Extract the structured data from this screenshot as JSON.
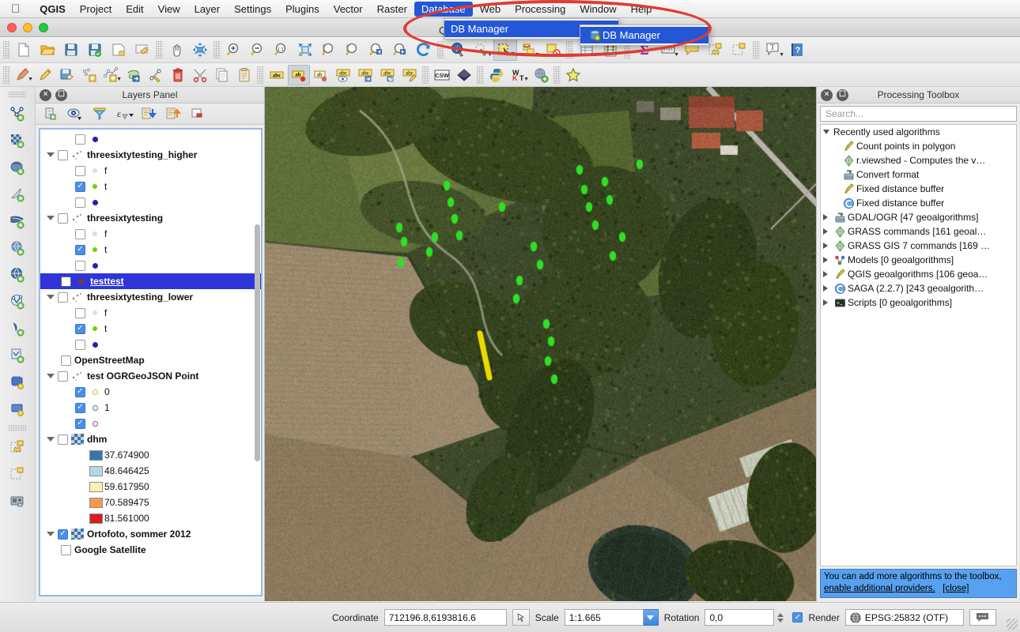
{
  "macmenu": {
    "apple_icon": "apple-icon",
    "items": [
      {
        "label": "QGIS",
        "bold": true,
        "active": false
      },
      {
        "label": "Project",
        "bold": false,
        "active": false
      },
      {
        "label": "Edit",
        "bold": false,
        "active": false
      },
      {
        "label": "View",
        "bold": false,
        "active": false
      },
      {
        "label": "Layer",
        "bold": false,
        "active": false
      },
      {
        "label": "Settings",
        "bold": false,
        "active": false
      },
      {
        "label": "Plugins",
        "bold": false,
        "active": false
      },
      {
        "label": "Vector",
        "bold": false,
        "active": false
      },
      {
        "label": "Raster",
        "bold": false,
        "active": false
      },
      {
        "label": "Database",
        "bold": false,
        "active": true
      },
      {
        "label": "Web",
        "bold": false,
        "active": false
      },
      {
        "label": "Processing",
        "bold": false,
        "active": false
      },
      {
        "label": "Window",
        "bold": false,
        "active": false
      },
      {
        "label": "Help",
        "bold": false,
        "active": false
      }
    ]
  },
  "window": {
    "title": "QGIS"
  },
  "database_menu": {
    "item_label": "DB Manager",
    "submenu_label": "DB Manager"
  },
  "toolbar_row1": [
    {
      "name": "new-project-icon",
      "title": "New Project"
    },
    {
      "name": "open-project-icon",
      "title": "Open Project"
    },
    {
      "name": "save-project-icon",
      "title": "Save Project"
    },
    {
      "name": "save-project-as-icon",
      "title": "Save Project As"
    },
    {
      "name": "new-print-composer-icon",
      "title": "New Print Composer"
    },
    {
      "name": "composer-manager-icon",
      "title": "Composer Manager"
    },
    {
      "name": "pan-map-icon",
      "title": "Pan Map"
    },
    {
      "name": "pan-to-selection-icon",
      "title": "Pan Map to Selection"
    },
    {
      "name": "zoom-in-icon",
      "title": "Zoom In"
    },
    {
      "name": "zoom-out-icon",
      "title": "Zoom Out"
    },
    {
      "name": "zoom-native-icon",
      "title": "Zoom to Native Resolution"
    },
    {
      "name": "zoom-full-icon",
      "title": "Zoom Full"
    },
    {
      "name": "zoom-to-selection-icon",
      "title": "Zoom to Selection"
    },
    {
      "name": "zoom-to-layer-icon",
      "title": "Zoom to Layer"
    },
    {
      "name": "zoom-last-icon",
      "title": "Zoom Last"
    },
    {
      "name": "zoom-next-icon",
      "title": "Zoom Next"
    },
    {
      "name": "refresh-icon",
      "title": "Refresh"
    },
    {
      "name": "identify-features-icon",
      "title": "Identify Features"
    },
    {
      "name": "select-features-icon",
      "title": "Select Features"
    },
    {
      "name": "select-by-rectangle-icon",
      "title": "Select by Rectangle"
    },
    {
      "name": "select-by-value-icon",
      "title": "Select Features by Value"
    },
    {
      "name": "deselect-features-icon",
      "title": "Deselect Features"
    },
    {
      "name": "open-attribute-table-icon",
      "title": "Open Attribute Table"
    },
    {
      "name": "field-calculator-icon",
      "title": "Field Calculator"
    },
    {
      "name": "statistical-summary-icon",
      "title": "Statistical Summary"
    },
    {
      "name": "measure-line-icon",
      "title": "Measure Line"
    },
    {
      "name": "map-tips-icon",
      "title": "Show Map Tips"
    },
    {
      "name": "new-bookmark-icon",
      "title": "New Bookmark"
    },
    {
      "name": "show-bookmarks-icon",
      "title": "Show Bookmarks"
    },
    {
      "name": "text-annotation-icon",
      "title": "Text Annotation"
    },
    {
      "name": "help-icon",
      "title": "Help"
    }
  ],
  "toolbar_row2": [
    {
      "name": "current-edits-icon",
      "title": "Current Edits"
    },
    {
      "name": "toggle-editing-icon",
      "title": "Toggle Editing"
    },
    {
      "name": "save-layer-edits-icon",
      "title": "Save Layer Edits"
    },
    {
      "name": "add-feature-point-icon",
      "title": "Add Feature"
    },
    {
      "name": "add-feature-line-icon",
      "title": "Add Feature Line"
    },
    {
      "name": "move-feature-icon",
      "title": "Move Feature"
    },
    {
      "name": "node-tool-icon",
      "title": "Node Tool"
    },
    {
      "name": "delete-selected-icon",
      "title": "Delete Selected"
    },
    {
      "name": "cut-features-icon",
      "title": "Cut Features"
    },
    {
      "name": "copy-features-icon",
      "title": "Copy Features"
    },
    {
      "name": "paste-features-icon",
      "title": "Paste Features"
    },
    {
      "name": "layer-labeling-icon",
      "title": "Layer Labeling Options"
    },
    {
      "name": "highlight-pinned-labels-icon",
      "title": "Highlight Pinned Labels"
    },
    {
      "name": "pin-labels-icon",
      "title": "Pin/Unpin Labels"
    },
    {
      "name": "show-hide-labels-icon",
      "title": "Show/Hide Labels"
    },
    {
      "name": "move-label-icon",
      "title": "Move Label"
    },
    {
      "name": "rotate-label-icon",
      "title": "Rotate Label"
    },
    {
      "name": "change-label-icon",
      "title": "Change Label"
    },
    {
      "name": "csw-icon",
      "title": "MetaSearch CSW"
    },
    {
      "name": "diamond-plugin-icon",
      "title": "Plugin"
    },
    {
      "name": "python-console-icon",
      "title": "Python Console"
    },
    {
      "name": "wkt-icon",
      "title": "WKT Tool"
    },
    {
      "name": "add-web-service-icon",
      "title": "Add Web Service"
    },
    {
      "name": "favorites-star-icon",
      "title": "Favorites"
    }
  ],
  "left_toolbar": [
    {
      "name": "add-vector-layer-icon",
      "title": "Add Vector Layer"
    },
    {
      "name": "add-raster-layer-icon",
      "title": "Add Raster Layer"
    },
    {
      "name": "add-postgis-layer-icon",
      "title": "Add PostGIS Layer"
    },
    {
      "name": "add-spatialite-layer-icon",
      "title": "Add SpatiaLite Layer"
    },
    {
      "name": "add-mssql-layer-icon",
      "title": "Add MSSQL Spatial Layer"
    },
    {
      "name": "add-oracle-layer-icon",
      "title": "Add Oracle Spatial Layer"
    },
    {
      "name": "add-wms-layer-icon",
      "title": "Add WMS/WMTS Layer"
    },
    {
      "name": "add-wcs-layer-icon",
      "title": "Add WCS Layer"
    },
    {
      "name": "add-wfs-layer-icon",
      "title": "Add WFS Layer"
    },
    {
      "name": "add-delimited-text-icon",
      "title": "Add Delimited Text Layer"
    },
    {
      "name": "new-shapefile-layer-icon",
      "title": "New Shapefile Layer"
    },
    {
      "name": "new-memory-layer-icon",
      "title": "New Memory Layer"
    },
    {
      "name": "new-bookmark-icon",
      "title": "New Bookmark"
    },
    {
      "name": "show-bookmarks-icon",
      "title": "Show Bookmarks"
    },
    {
      "name": "open-attribute-icon",
      "title": "Open Table"
    }
  ],
  "layers_panel": {
    "title": "Layers Panel",
    "toolbar": [
      {
        "name": "add-group-icon",
        "title": "Add Group"
      },
      {
        "name": "manage-layer-visibility-icon",
        "title": "Manage Layer Visibility"
      },
      {
        "name": "filter-legend-icon",
        "title": "Filter Legend by Map Content"
      },
      {
        "name": "filter-legend-expression-icon",
        "title": "Filter Legend by Expression"
      },
      {
        "name": "expand-all-icon",
        "title": "Expand All"
      },
      {
        "name": "collapse-all-icon",
        "title": "Collapse All"
      },
      {
        "name": "remove-layer-icon",
        "title": "Remove Layer/Group"
      }
    ],
    "rows": [
      {
        "type": "symbol",
        "indent": 2,
        "checked": false,
        "symbol": "dot",
        "color": "#2222aa",
        "label": ""
      },
      {
        "type": "layer",
        "indent": 0,
        "expand": "down",
        "checked": false,
        "symbol": "points",
        "label": "threesixtytesting_higher",
        "bold": true
      },
      {
        "type": "symbol",
        "indent": 2,
        "checked": false,
        "symbol": "dot",
        "color": "#efd6cf",
        "label": "f"
      },
      {
        "type": "symbol",
        "indent": 2,
        "checked": true,
        "symbol": "dot",
        "color": "#6dd400",
        "label": "t"
      },
      {
        "type": "symbol",
        "indent": 2,
        "checked": false,
        "symbol": "dot",
        "color": "#2222aa",
        "label": ""
      },
      {
        "type": "layer",
        "indent": 0,
        "expand": "down",
        "checked": false,
        "symbol": "points",
        "label": "threesixtytesting",
        "bold": true
      },
      {
        "type": "symbol",
        "indent": 2,
        "checked": false,
        "symbol": "dot",
        "color": "#efd6cf",
        "label": "f"
      },
      {
        "type": "symbol",
        "indent": 2,
        "checked": true,
        "symbol": "dot",
        "color": "#6dd400",
        "label": "t"
      },
      {
        "type": "symbol",
        "indent": 2,
        "checked": false,
        "symbol": "dot",
        "color": "#2222aa",
        "label": ""
      },
      {
        "type": "layer",
        "indent": 1,
        "checked": false,
        "symbol": "dot",
        "color": "#7a3b3b",
        "label": "testtest",
        "selected": true
      },
      {
        "type": "layer",
        "indent": 0,
        "expand": "down",
        "checked": false,
        "symbol": "points",
        "label": "threesixtytesting_lower",
        "bold": true
      },
      {
        "type": "symbol",
        "indent": 2,
        "checked": false,
        "symbol": "dot",
        "color": "#efd6cf",
        "label": "f"
      },
      {
        "type": "symbol",
        "indent": 2,
        "checked": true,
        "symbol": "dot",
        "color": "#6dd400",
        "label": "t"
      },
      {
        "type": "symbol",
        "indent": 2,
        "checked": false,
        "symbol": "dot",
        "color": "#2222aa",
        "label": ""
      },
      {
        "type": "layer",
        "indent": 1,
        "checked": false,
        "symbol": "none",
        "label": "OpenStreetMap",
        "bold": true
      },
      {
        "type": "layer",
        "indent": 0,
        "expand": "down",
        "checked": false,
        "symbol": "points",
        "label": "test OGRGeoJSON Point",
        "bold": true
      },
      {
        "type": "symbol",
        "indent": 2,
        "checked": true,
        "symbol": "ring",
        "color": "#b5c733",
        "label": "0"
      },
      {
        "type": "symbol",
        "indent": 2,
        "checked": true,
        "symbol": "ring",
        "color": "#4c7f85",
        "label": "1"
      },
      {
        "type": "symbol",
        "indent": 2,
        "checked": true,
        "symbol": "ring",
        "color": "#a23fa0",
        "label": ""
      },
      {
        "type": "raster",
        "indent": 0,
        "expand": "down",
        "checked": false,
        "label": "dhm",
        "bold": true
      },
      {
        "type": "ramp",
        "indent": 2,
        "color": "#3776ad",
        "label": "37.674900"
      },
      {
        "type": "ramp",
        "indent": 2,
        "color": "#b6d7e8",
        "label": "48.646425"
      },
      {
        "type": "ramp",
        "indent": 2,
        "color": "#fdf0b4",
        "label": "59.617950"
      },
      {
        "type": "ramp",
        "indent": 2,
        "color": "#f79a50",
        "label": "70.589475"
      },
      {
        "type": "ramp",
        "indent": 2,
        "color": "#d62020",
        "label": "81.561000"
      },
      {
        "type": "raster",
        "indent": 0,
        "expand": "down",
        "checked": true,
        "label": "Ortofoto, sommer 2012",
        "bold": true
      },
      {
        "type": "layer",
        "indent": 1,
        "checked": false,
        "symbol": "none",
        "label": "Google Satellite",
        "bold": true
      }
    ]
  },
  "processing_panel": {
    "title": "Processing Toolbox",
    "search_placeholder": "Search...",
    "tree": [
      {
        "level": 0,
        "expand": "down",
        "icon": "none",
        "label": "Recently used algorithms"
      },
      {
        "level": 1,
        "expand": "none",
        "icon": "qgis-algorithm-icon",
        "label": "Count points in polygon"
      },
      {
        "level": 1,
        "expand": "none",
        "icon": "grass-algorithm-icon",
        "label": "r.viewshed - Computes the v…"
      },
      {
        "level": 1,
        "expand": "none",
        "icon": "gdal-algorithm-icon",
        "label": "Convert format"
      },
      {
        "level": 1,
        "expand": "none",
        "icon": "qgis-algorithm-icon",
        "label": "Fixed distance buffer"
      },
      {
        "level": 1,
        "expand": "none",
        "icon": "saga-algorithm-icon",
        "label": "Fixed distance buffer"
      },
      {
        "level": 0,
        "expand": "right",
        "icon": "gdal-algorithm-icon",
        "label": "GDAL/OGR [47 geoalgorithms]"
      },
      {
        "level": 0,
        "expand": "right",
        "icon": "grass-algorithm-icon",
        "label": "GRASS commands [161 geoal…"
      },
      {
        "level": 0,
        "expand": "right",
        "icon": "grass-algorithm-icon",
        "label": "GRASS GIS 7 commands [169 …"
      },
      {
        "level": 0,
        "expand": "right",
        "icon": "models-icon",
        "label": "Models [0 geoalgorithms]"
      },
      {
        "level": 0,
        "expand": "right",
        "icon": "qgis-algorithm-icon",
        "label": "QGIS geoalgorithms [106 geoa…"
      },
      {
        "level": 0,
        "expand": "right",
        "icon": "saga-algorithm-icon",
        "label": "SAGA (2.2.7) [243 geoalgorith…"
      },
      {
        "level": 0,
        "expand": "right",
        "icon": "scripts-icon",
        "label": "Scripts [0 geoalgorithms]"
      }
    ],
    "infobox": {
      "text_1": "You can add more algorithms to the toolbox,",
      "link_1": "enable additional providers.",
      "link_2": "[close]"
    }
  },
  "statusbar": {
    "coordinate_label": "Coordinate",
    "coordinate_value": "712196.8,6193816.6",
    "coordinate_toggle_icon": "coordinate-capture-icon",
    "scale_label": "Scale",
    "scale_value": "1:1.665",
    "rotation_label": "Rotation",
    "rotation_value": "0,0",
    "render_label": "Render",
    "render_checked": true,
    "crs_value": "EPSG:25832 (OTF)",
    "crs_icon": "globe-icon",
    "messages_icon": "messages-icon"
  },
  "annotation": {
    "ellipse_color": "#e03b2f"
  },
  "map": {
    "description": "Aerial orthophoto of farmland, woods, buildings and a pond with a yellow line feature and green point markers"
  }
}
